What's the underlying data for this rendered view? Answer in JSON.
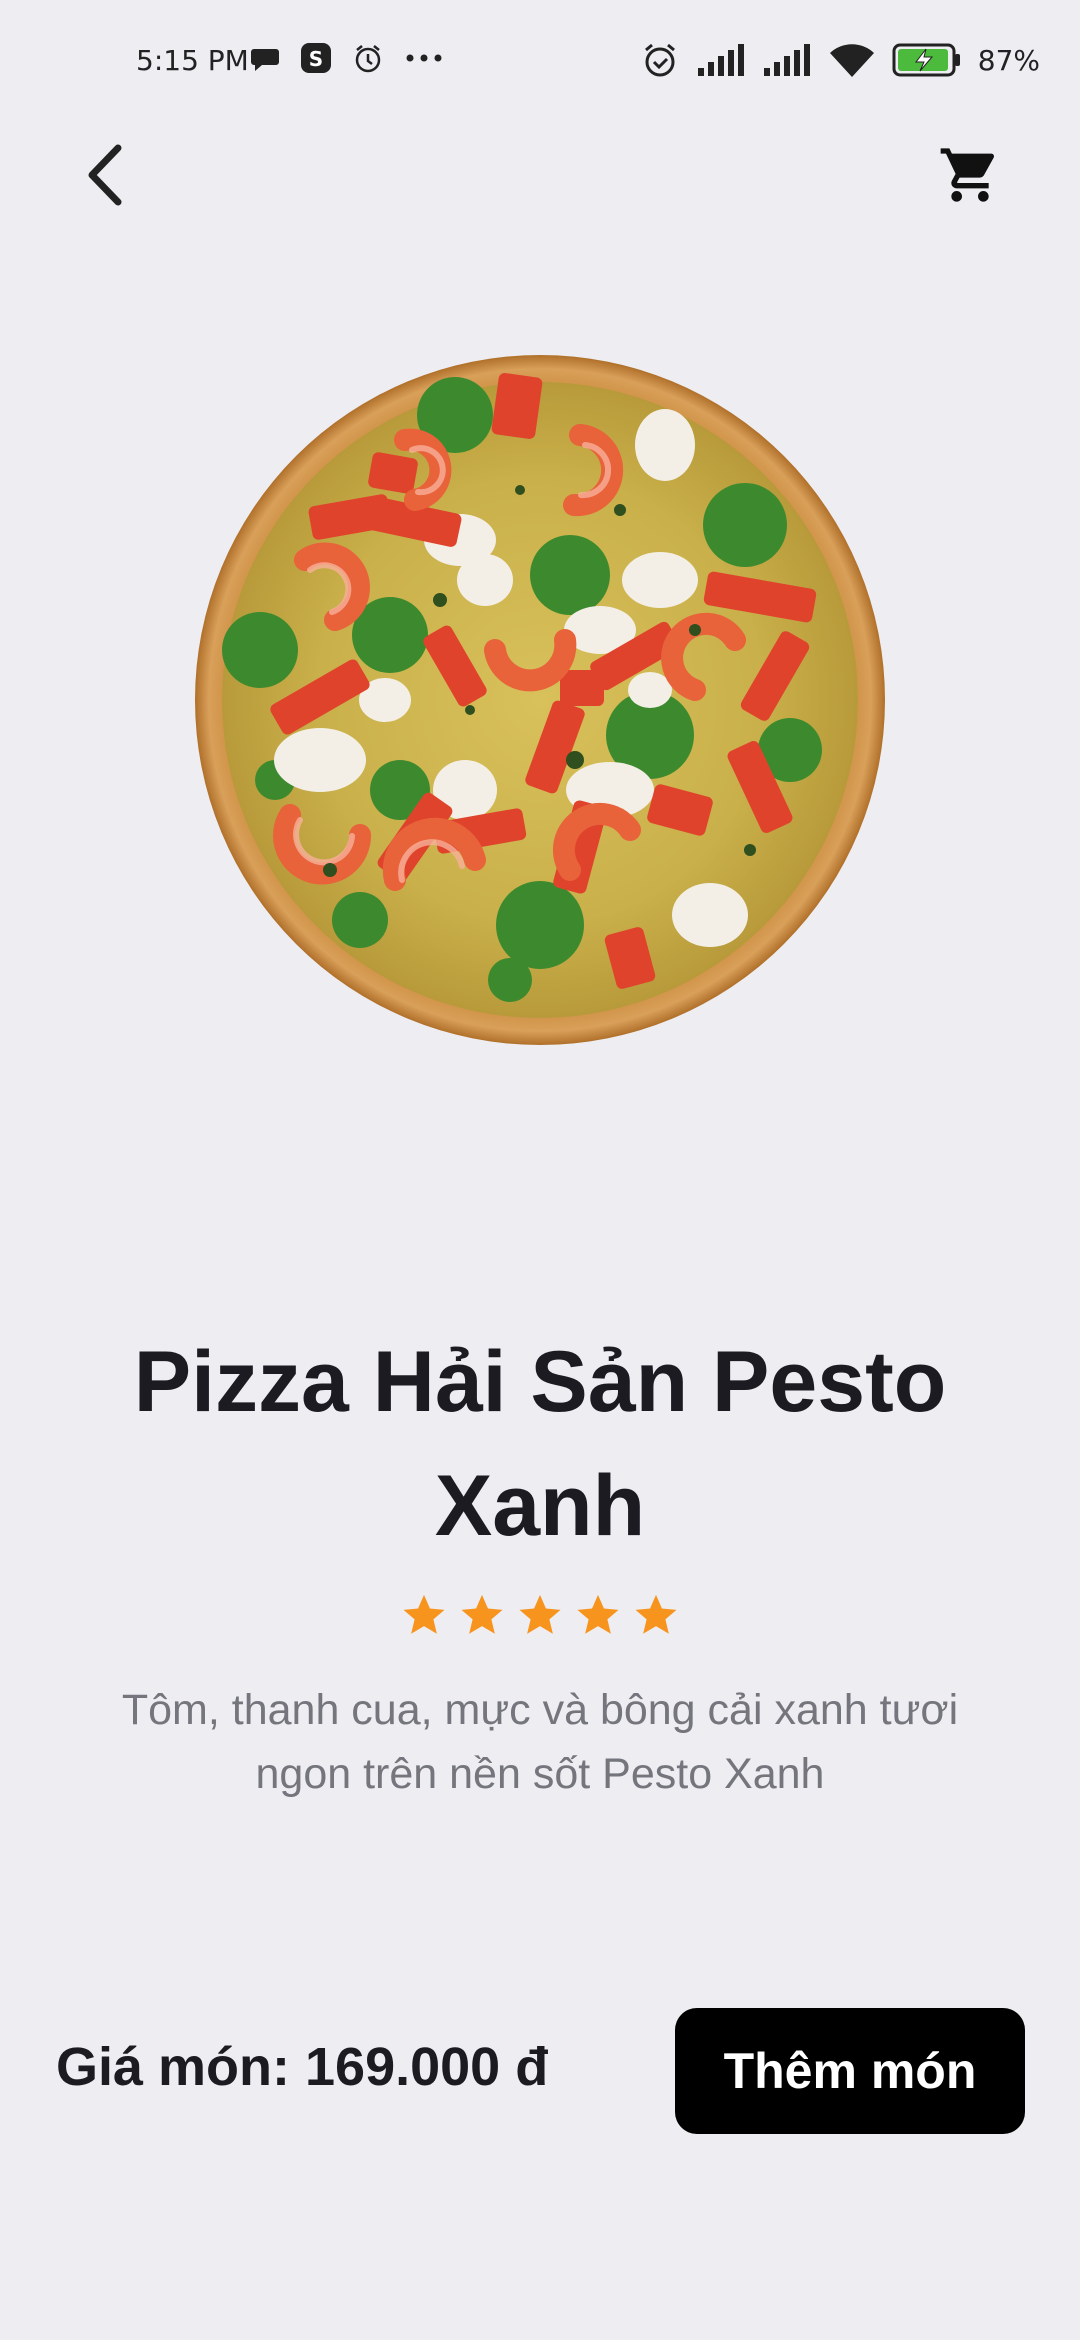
{
  "status_bar": {
    "time": "5:15 PM",
    "battery_percent": "87%",
    "icons": [
      "chat-icon",
      "s-app-icon",
      "alarm-icon",
      "more-dots-icon",
      "alarm-clock-icon",
      "signal-icon",
      "signal-icon",
      "wifi-icon",
      "battery-charging-icon"
    ]
  },
  "header": {
    "back_icon": "chevron-left-icon",
    "cart_icon": "shopping-cart-icon"
  },
  "product": {
    "title": "Pizza Hải Sản Pesto Xanh",
    "rating": 5,
    "rating_max": 5,
    "description": "Tôm, thanh cua, mực và bông cải xanh tươi ngon trên nền sốt Pesto Xanh",
    "price": "Giá món: 169.000 đ",
    "add_button_label": "Thêm món"
  },
  "colors": {
    "background": "#ededf2",
    "star": "#f7941d",
    "button_bg": "#000000",
    "description_text": "#75757d"
  }
}
